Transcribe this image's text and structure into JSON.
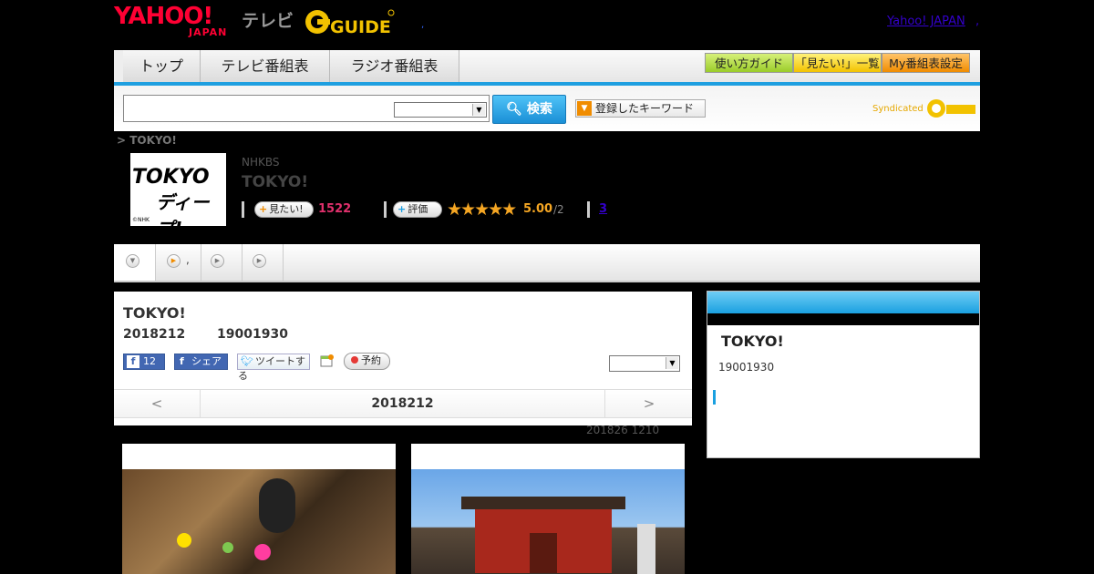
{
  "header": {
    "yahoo_logo": "YAHOO!",
    "yahoo_logo_sub": "JAPAN",
    "tv_label": "テレビ",
    "gguide_logo": "GUIDE",
    "yahoo_japan_link": "Yahoo! JAPAN",
    "dot_separator": ",",
    "small_dot": ","
  },
  "nav": {
    "tabs": [
      "トップ",
      "テレビ番組表",
      "ラジオ番組表"
    ],
    "buttons": [
      "使い方ガイド",
      "「見たい!」一覧",
      "My番組表設定"
    ]
  },
  "search": {
    "input_value": "",
    "select_value": "",
    "search_button": "検索",
    "keywords_button": "登録したキーワード",
    "syndicated_label": "Syndicated"
  },
  "breadcrumb": "> TOKYO!",
  "program": {
    "thumbnail_line1": "TOKYO",
    "thumbnail_line2": "ディープ!",
    "thumbnail_credit": "©NHK",
    "channel": "NHKBS",
    "title": "TOKYO!",
    "want_button": "見たい!",
    "want_count": "1522",
    "rate_button": "評価",
    "stars": "★★★★★",
    "rating": "5.00",
    "rating_count": "/2",
    "reply_count": "3"
  },
  "subtabs": {
    "tab2_label": ","
  },
  "main": {
    "title": "TOKYO!",
    "date": "2018212",
    "time": "19001930",
    "fb_count": "12",
    "share_label": "シェア",
    "tweet_label": "ツイートする",
    "reserve_label": "予約",
    "select_value": "",
    "prev_label": "<",
    "nav_date": "2018212",
    "next_label": ">",
    "update_note": "201826  1210"
  },
  "side": {
    "title": "TOKYO!",
    "time": "19001930"
  },
  "colors": {
    "accent_blue": "#1e9fe0",
    "yahoo_red": "#ff0033",
    "star_orange": "#f5a623",
    "want_pink": "#e0306c",
    "link_blue": "#3300cc"
  }
}
